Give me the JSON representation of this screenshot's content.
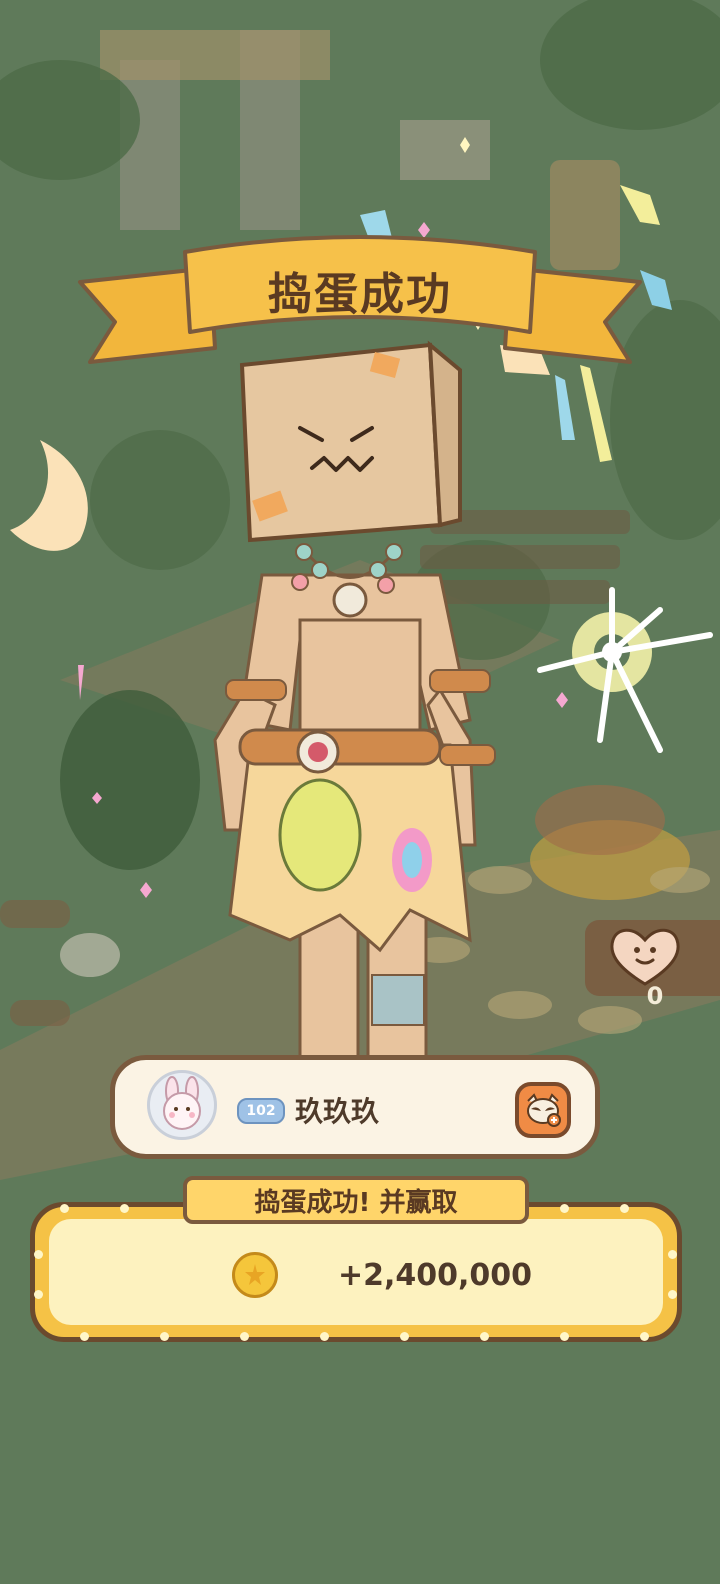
{
  "title": "捣蛋成功",
  "heart_counter": {
    "icon": "heart-smile-icon",
    "value": "0"
  },
  "player": {
    "avatar_icon": "bunny-avatar-icon",
    "level": "102",
    "name": "玖玖玖",
    "add_friend_icon": "raccoon-add-friend-icon"
  },
  "reward": {
    "header": "捣蛋成功! 并赢取",
    "coin_icon": "gold-coin-icon",
    "amount": "+2,400,000"
  },
  "colors": {
    "overlay": "#5f7a5a",
    "ribbon": "#f6c14a",
    "panel": "#f5c246",
    "panel_inner": "#fdf2bf",
    "card": "#fbf3e4",
    "border": "#7a5a3e"
  }
}
